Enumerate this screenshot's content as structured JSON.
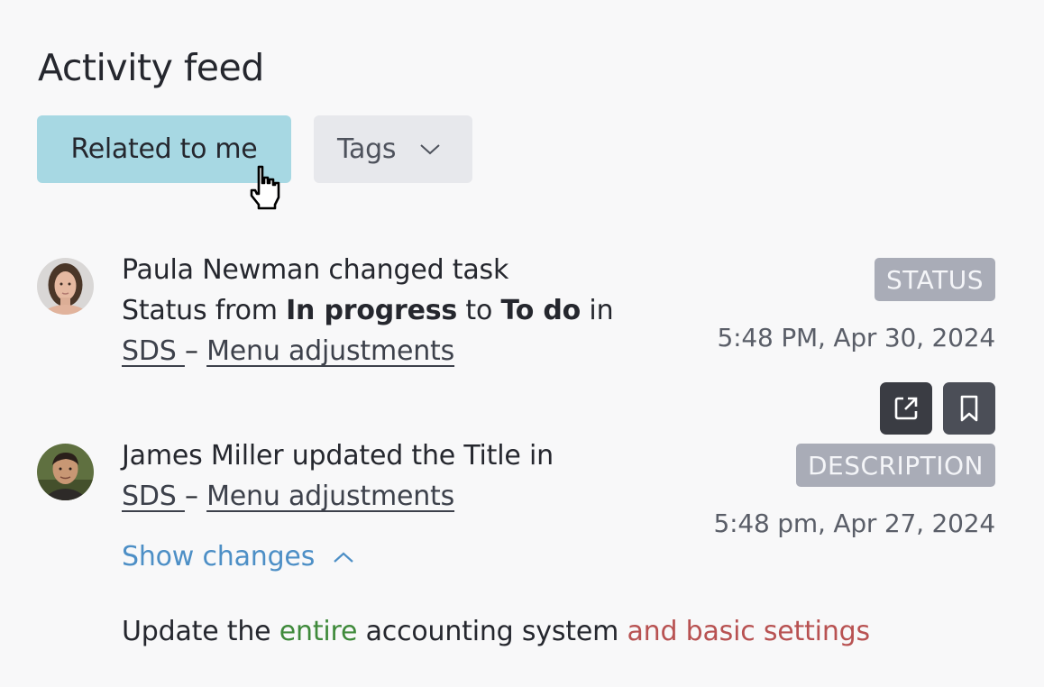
{
  "header": {
    "title": "Activity feed"
  },
  "filters": {
    "related_label": "Related to me",
    "tags_label": "Tags"
  },
  "colors": {
    "related_button_bg": "#a7d8e3",
    "badge_bg": "#a9acb7",
    "link_blue": "#4d8fc6",
    "added_green": "#3f8a3b",
    "removed_red": "#b85252"
  },
  "entries": [
    {
      "user": "Paula Newman",
      "line1": "Paula Newman changed task",
      "status_prefix": "Status from ",
      "from_value": "In progress",
      "to_word": " to ",
      "to_value": "To do",
      "in_word": " in",
      "project": "SDS ",
      "separator": "– ",
      "task": "Menu adjustments",
      "badge": "STATUS",
      "timestamp": "5:48 PM, Apr 30, 2024",
      "avatar_icon": "avatar-woman"
    },
    {
      "user": "James Miller",
      "line1": "James Miller updated the Title in",
      "project": "SDS ",
      "separator": "– ",
      "task": "Menu adjustments",
      "badge": "DESCRIPTION",
      "timestamp": "5:48 pm, Apr 27, 2024",
      "show_changes_label": "Show changes",
      "avatar_icon": "avatar-man"
    }
  ],
  "change": {
    "part1": "Update the ",
    "added": "entire",
    "part2": " accounting system ",
    "removed": "and basic settings"
  },
  "actions": {
    "open_icon": "external-link-icon",
    "bookmark_icon": "bookmark-icon"
  }
}
